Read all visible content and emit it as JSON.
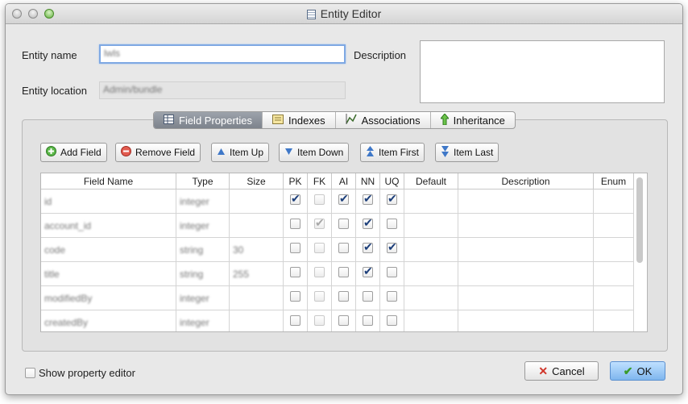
{
  "window": {
    "title": "Entity Editor"
  },
  "form": {
    "entity_name_label": "Entity name",
    "entity_name_value": "lwls",
    "entity_location_label": "Entity location",
    "entity_location_value": "Admin/bundle",
    "description_label": "Description",
    "description_value": ""
  },
  "tabs": [
    {
      "label": "Field Properties",
      "icon": "grid-icon",
      "active": true
    },
    {
      "label": "Indexes",
      "icon": "index-icon",
      "active": false
    },
    {
      "label": "Associations",
      "icon": "associations-icon",
      "active": false
    },
    {
      "label": "Inheritance",
      "icon": "arrow-up-icon",
      "active": false
    }
  ],
  "toolbar": {
    "add_field": "Add Field",
    "remove_field": "Remove Field",
    "item_up": "Item Up",
    "item_down": "Item Down",
    "item_first": "Item First",
    "item_last": "Item Last"
  },
  "table": {
    "columns": [
      "Field Name",
      "Type",
      "Size",
      "PK",
      "FK",
      "AI",
      "NN",
      "UQ",
      "Default",
      "Description",
      "Enum"
    ],
    "rows": [
      {
        "name": "id",
        "type": "integer",
        "size": "",
        "pk": true,
        "fk": false,
        "ai": true,
        "nn": true,
        "uq": true
      },
      {
        "name": "account_id",
        "type": "integer",
        "size": "",
        "pk": false,
        "fk": true,
        "ai": false,
        "nn": true,
        "uq": false
      },
      {
        "name": "code",
        "type": "string",
        "size": "30",
        "pk": false,
        "fk": false,
        "ai": false,
        "nn": true,
        "uq": true
      },
      {
        "name": "title",
        "type": "string",
        "size": "255",
        "pk": false,
        "fk": false,
        "ai": false,
        "nn": true,
        "uq": false
      },
      {
        "name": "modifiedBy",
        "type": "integer",
        "size": "",
        "pk": false,
        "fk": false,
        "ai": false,
        "nn": false,
        "uq": false
      },
      {
        "name": "createdBy",
        "type": "integer",
        "size": "",
        "pk": false,
        "fk": false,
        "ai": false,
        "nn": false,
        "uq": false
      }
    ]
  },
  "footer": {
    "show_property_editor": "Show property editor",
    "show_property_editor_checked": false,
    "cancel": "Cancel",
    "ok": "OK"
  }
}
